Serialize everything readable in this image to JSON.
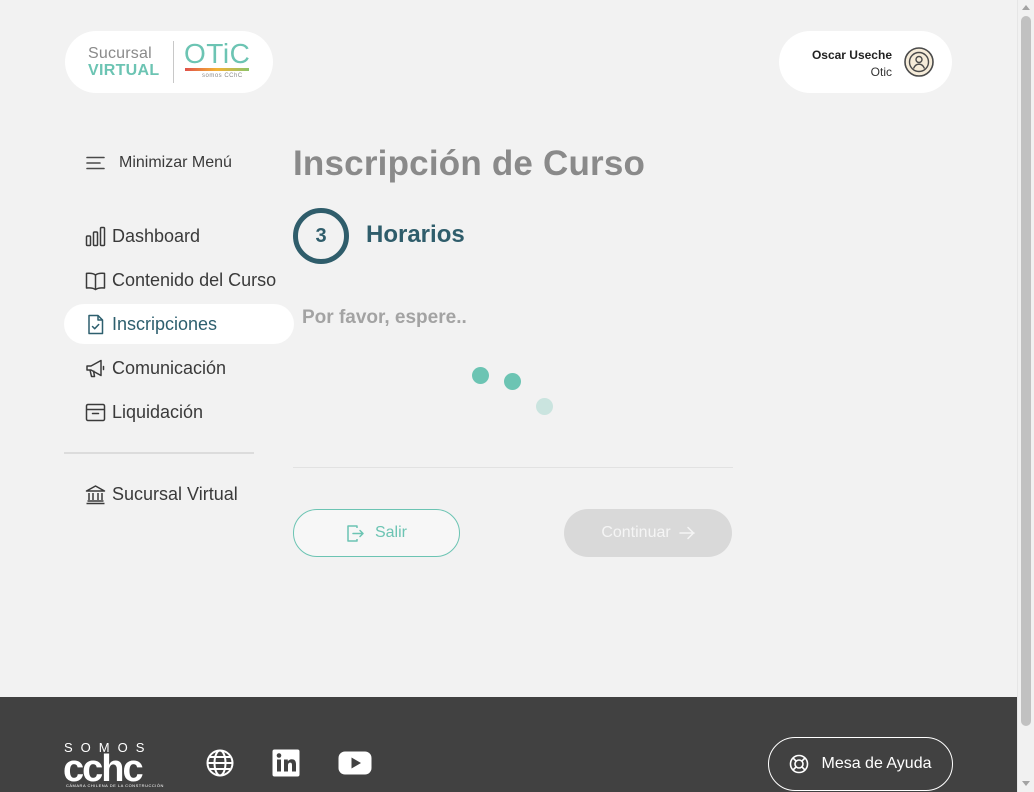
{
  "logo": {
    "sucursal": "Sucursal",
    "virtual": "VIRTUAL",
    "otic": "OTiC",
    "somos": "somos CChC"
  },
  "user": {
    "name": "Oscar Useche",
    "org": "Otic"
  },
  "sidebar": {
    "toggle_label": "Minimizar Menú",
    "items": [
      {
        "label": "Dashboard",
        "icon": "bar-chart-icon",
        "active": false
      },
      {
        "label": "Contenido del Curso",
        "icon": "book-icon",
        "active": false
      },
      {
        "label": "Inscripciones",
        "icon": "document-check-icon",
        "active": true
      },
      {
        "label": "Comunicación",
        "icon": "megaphone-icon",
        "active": false
      },
      {
        "label": "Liquidación",
        "icon": "archive-icon",
        "active": false
      }
    ],
    "secondary_items": [
      {
        "label": "Sucursal Virtual",
        "icon": "bank-icon"
      }
    ]
  },
  "main": {
    "title": "Inscripción de Curso",
    "step_number": "3",
    "step_title": "Horarios",
    "wait_text": "Por favor, espere..",
    "exit_label": "Salir",
    "continue_label": "Continuar"
  },
  "footer": {
    "brand_somos": "SOMOS",
    "brand_cchc": "cchc",
    "brand_sub": "CÁMARA CHILENA DE LA CONSTRUCCIÓN",
    "social_icons": [
      "globe-icon",
      "linkedin-icon",
      "youtube-icon"
    ],
    "help_label": "Mesa de Ayuda"
  },
  "colors": {
    "accent": "#6cc4b3",
    "primary_dark": "#2f5d6b",
    "background": "#f2f2f2",
    "footer": "#414141"
  }
}
